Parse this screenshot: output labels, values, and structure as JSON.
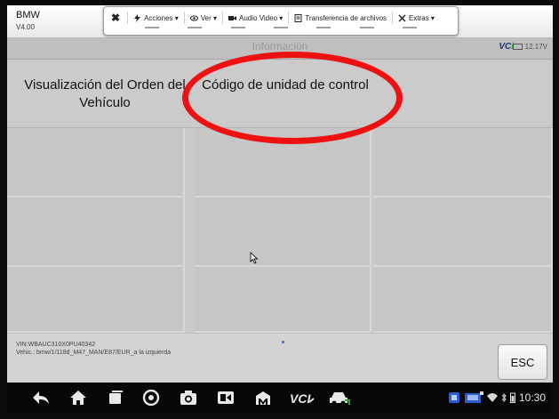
{
  "app": {
    "brand": "BMW",
    "version": "V4.00"
  },
  "toolbar": {
    "close_label": "✖",
    "items": [
      {
        "label": "Acciones ▾",
        "icon": "lightning-icon"
      },
      {
        "label": "Ver ▾",
        "icon": "eye-icon"
      },
      {
        "label": "Audio Video ▾",
        "icon": "video-icon"
      },
      {
        "label": "Transferencia de archivos",
        "icon": "file-transfer-icon"
      },
      {
        "label": "Extras ▾",
        "icon": "tools-icon"
      }
    ]
  },
  "title_strip": {
    "title": "Información",
    "vci_main": "VC",
    "vci_accent": "i",
    "voltage": "12.17V"
  },
  "headers": [
    "Visualización del Orden del Vehículo",
    "Código de unidad de control"
  ],
  "info": {
    "vin_line": "VIN:WBAUC310X0PU40342",
    "vehicle_line": "Vehic.: bmw/1/118d_M47_MAN/E87/EUR_a la izquierda",
    "esc_label": "ESC"
  },
  "status_bar": {
    "time": "10:30"
  },
  "colors": {
    "annotation": "#ee1111",
    "vci_blue": "#1a3a7a",
    "vci_green": "#2aa12a"
  }
}
